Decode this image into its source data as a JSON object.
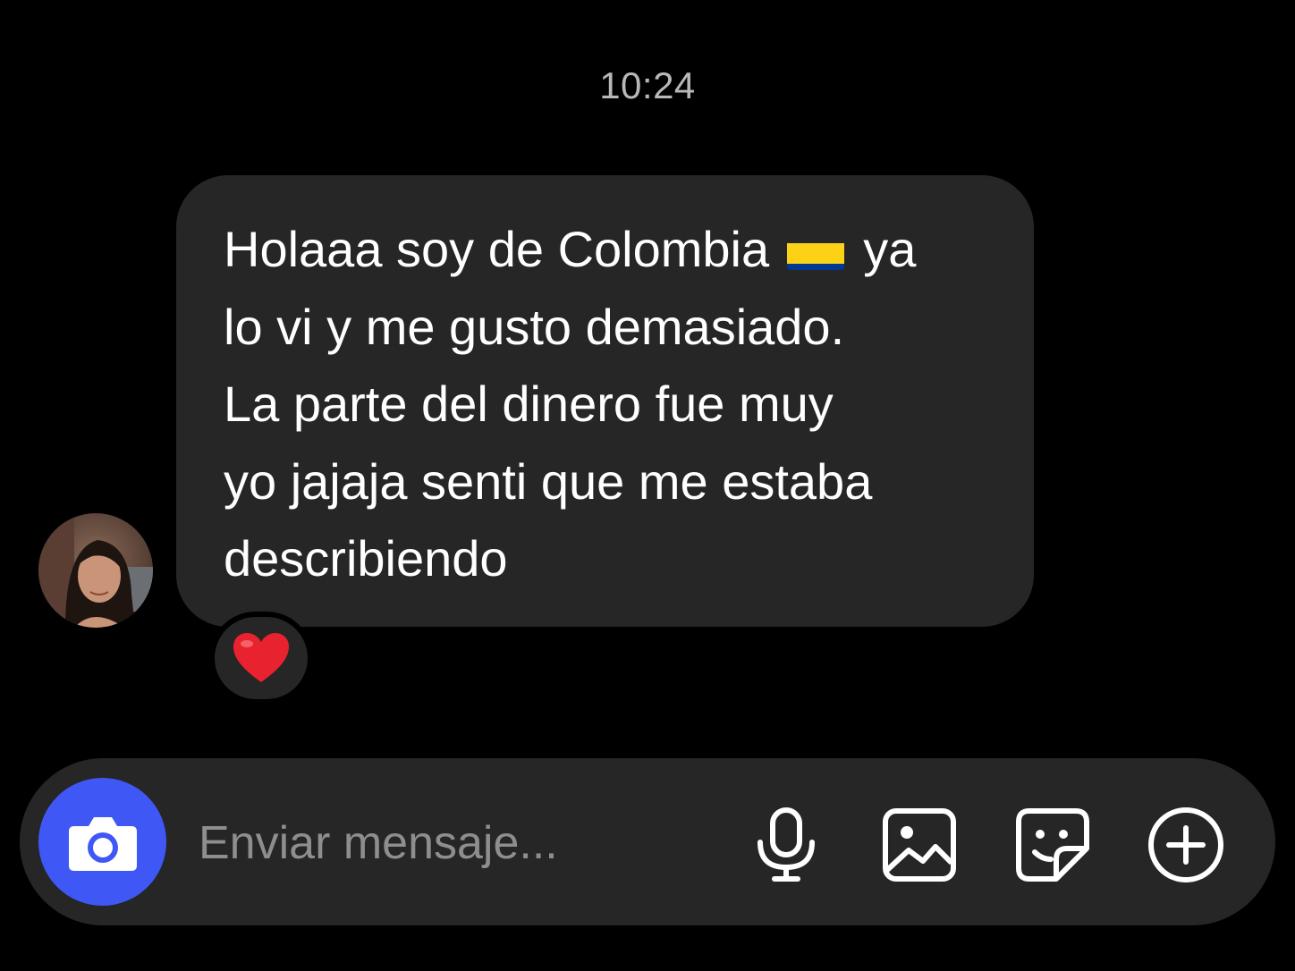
{
  "chat": {
    "timestamp": "10:24",
    "message": {
      "lines": [
        "Holaaa soy de Colombia",
        "ya",
        "lo vi y me gusto demasiado.",
        "La parte del dinero fue muy",
        "yo jajaja senti que me estaba",
        "describiendo"
      ],
      "flag_icon": "colombia-flag-emoji",
      "reaction": "❤️"
    },
    "sender_avatar": "avatar"
  },
  "composer": {
    "placeholder": "Enviar mensaje...",
    "icons": {
      "camera": "camera-icon",
      "microphone": "microphone-icon",
      "gallery": "image-icon",
      "sticker": "sticker-icon",
      "more": "plus-icon"
    }
  },
  "colors": {
    "background": "#000000",
    "bubble": "#262626",
    "accent": "#3f58f5",
    "text": "#ffffff",
    "muted": "#8e8e8e"
  }
}
